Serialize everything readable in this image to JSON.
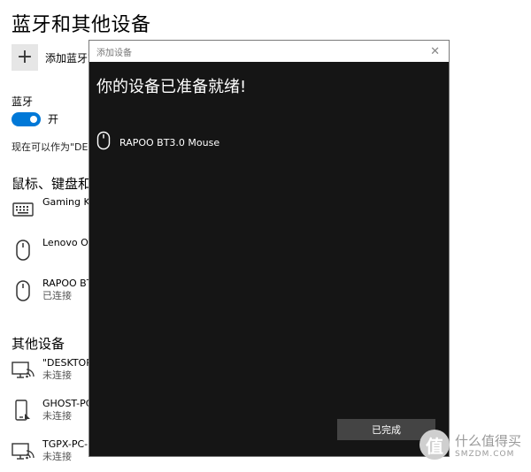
{
  "settings": {
    "page_title": "蓝牙和其他设备",
    "add_label": "添加蓝牙或",
    "bluetooth_label": "蓝牙",
    "toggle_text": "开",
    "discoverable_text": "现在可以作为\"DE",
    "section_input": "鼠标、键盘和",
    "section_other": "其他设备"
  },
  "input_devices": [
    {
      "name": "Gaming KB",
      "status": "",
      "icon": "keyboard-icon"
    },
    {
      "name": "Lenovo Op",
      "status": "",
      "icon": "mouse-icon"
    },
    {
      "name": "RAPOO BT",
      "status": "已连接",
      "icon": "mouse-icon"
    }
  ],
  "other_devices": [
    {
      "name": "\"DESKTOP-",
      "status": "未连接",
      "icon": "pc-wireless-icon"
    },
    {
      "name": "GHOST-PC",
      "status": "未连接",
      "icon": "phone-pc-icon"
    },
    {
      "name": "TGPX-PC-L",
      "status": "未连接",
      "icon": "pc-wireless-icon"
    }
  ],
  "dialog": {
    "title": "添加设备",
    "close_glyph": "✕",
    "heading": "你的设备已准备就绪!",
    "device_name": "RAPOO BT3.0 Mouse",
    "done_label": "已完成"
  },
  "watermark": {
    "badge": "值",
    "line1": "什么值得买",
    "line2": "SMZDM.COM"
  },
  "colors": {
    "accent": "#0078d7",
    "dialog_bg": "#151515",
    "button_bg": "#444444"
  }
}
